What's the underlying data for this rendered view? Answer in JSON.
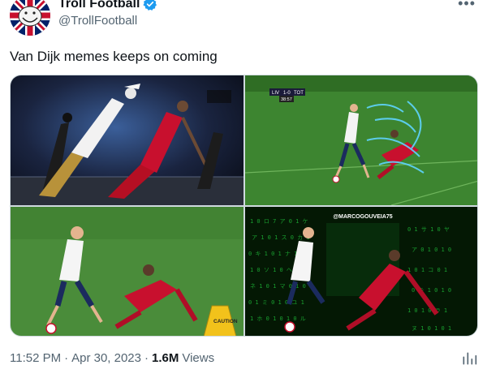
{
  "author": {
    "display_name": "Troll Football",
    "handle": "@TrollFootball",
    "avatar_icon": "troll-face-union-jack-avatar",
    "verified_color": "#1d9bf0"
  },
  "more_icon": "more-horizontal-icon",
  "tweet": {
    "text": "Van Dijk memes keeps on coming"
  },
  "media": {
    "panels": [
      {
        "label": "michael-jackson-lean-meme"
      },
      {
        "label": "broadcast-hologram-meme",
        "scoreboard": {
          "home": "LIV",
          "score": "1-0",
          "away": "TOT",
          "clock": "38:57"
        }
      },
      {
        "label": "wet-floor-sign-meme",
        "sign_text": "CAUTION"
      },
      {
        "label": "matrix-meme",
        "watermark": "@MARCOGOUVEIA75"
      }
    ]
  },
  "meta": {
    "time": "11:52 PM",
    "separator": "·",
    "date": "Apr 30, 2023",
    "views_count": "1.6M",
    "views_label": "Views"
  },
  "analytics_icon": "analytics-icon",
  "colors": {
    "text_primary": "#0f1419",
    "text_secondary": "#536471",
    "pitch_green": "#3e8a2e",
    "liverpool_red": "#c8102e"
  }
}
